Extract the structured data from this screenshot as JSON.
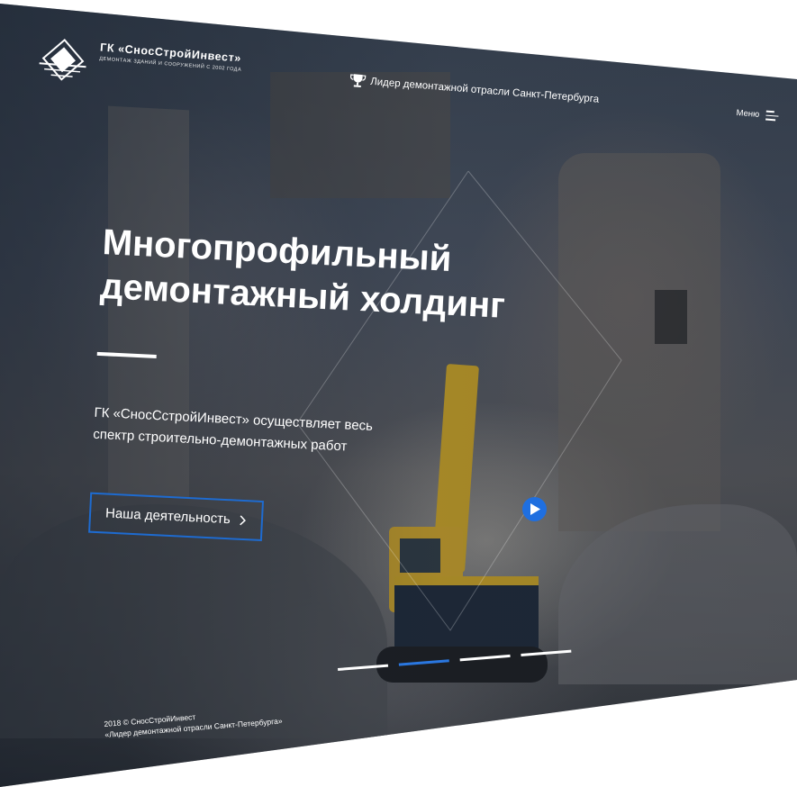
{
  "header": {
    "logo_title": "ГК «СносСтройИнвест»",
    "logo_subtitle": "ДЕМОНТАЖ ЗДАНИЙ И СООРУЖЕНИЙ С 2002 ГОДА",
    "award_text": "Лидер демонтажной отрасли Санкт-Петербурга",
    "award_icon": "trophy-icon",
    "menu_label": "Меню",
    "menu_icon": "hamburger-icon"
  },
  "hero": {
    "title_line1": "Многопрофильный",
    "title_line2": "демонтажный холдинг",
    "description_line1": "ГК «СносСстройИнвест» осуществляет весь",
    "description_line2": "спектр строительно-демонтажных работ",
    "cta_label": "Наша деятельность",
    "cta_icon": "chevron-right-icon"
  },
  "video": {
    "play_icon": "play-icon"
  },
  "slider": {
    "count": 4,
    "active_index": 1
  },
  "footer": {
    "copyright": "2018 © СносСтройИнвест",
    "tagline": "«Лидер демонтажной отрасли Санкт-Петербурга»"
  },
  "colors": {
    "accent": "#1e6bd0",
    "text": "#ffffff",
    "play_button": "#1f6fe0"
  }
}
